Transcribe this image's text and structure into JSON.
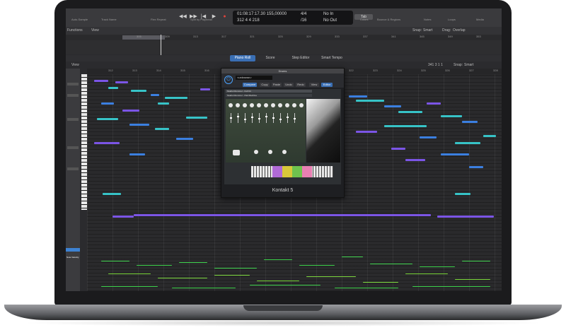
{
  "lcd": {
    "line1": "01:08:17:17.30  155,00000",
    "line2": "312   4   4   218",
    "sig_top": "4/4",
    "sig_bottom": "/16",
    "key_top": "No In",
    "key_bottom": "No Out",
    "tempo_label": "Keep Tempo"
  },
  "toolbar": {
    "items": [
      "Auto-Sample",
      "Track Name",
      "Flex Repeat",
      "Spot Snap",
      "Split by Playhead",
      "Split by Locators",
      "Join",
      "Bounce & Regions",
      "Colors",
      "Notes",
      "Loops",
      "Media"
    ],
    "pill": "Tab"
  },
  "arrange": {
    "left_menu": "Functions",
    "view": "View",
    "snap_label": "Snap:",
    "snap_value": "Smart",
    "drag_label": "Drag:",
    "drag_value": "Overlap",
    "ticks": [
      "305",
      "309",
      "313",
      "317",
      "321",
      "325",
      "329",
      "333",
      "337",
      "341",
      "345",
      "349",
      "353"
    ]
  },
  "tabs": [
    "Piano Roll",
    "Score",
    "Step Editor",
    "Smart Tempo"
  ],
  "pianoroll": {
    "view": "View",
    "snap_label": "Snap:",
    "snap_value": "Smart",
    "position": "341 3 1 1",
    "ticks": [
      "312",
      "313",
      "314",
      "315",
      "316",
      "317",
      "318",
      "319",
      "320",
      "321",
      "322",
      "323",
      "324",
      "325",
      "326",
      "327",
      "328"
    ]
  },
  "inspector": {
    "label": "Note Velocity"
  },
  "plugin": {
    "title": "Drums",
    "preset": "<unknown>",
    "buttons": [
      "Compare",
      "Copy",
      "Paste",
      "Undo",
      "Redo",
      "View",
      "Editor"
    ],
    "instrument1": "Studio Drummer - Full Kit",
    "instrument2": "Studio Drummer - Pad Machine",
    "footer": "Kontakt 5"
  },
  "colors": {
    "teal": "#37c3c7",
    "blue": "#3b7fe0",
    "purple": "#7b55e6",
    "green": "#3ed14c",
    "accent": "#3a6fb4"
  }
}
